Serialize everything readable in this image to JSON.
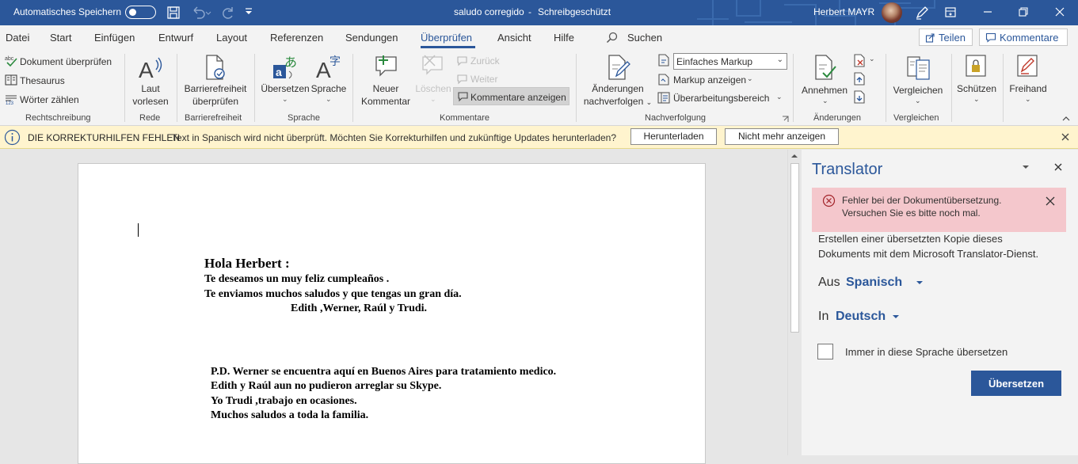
{
  "title_bar": {
    "autosave_label": "Automatisches Speichern",
    "doc_title": "saludo corregido",
    "separator": "-",
    "read_only": "Schreibgeschützt",
    "user_name": "Herbert MAYR"
  },
  "menu": {
    "tabs": [
      "Datei",
      "Start",
      "Einfügen",
      "Entwurf",
      "Layout",
      "Referenzen",
      "Sendungen",
      "Überprüfen",
      "Ansicht",
      "Hilfe"
    ],
    "active": "Überprüfen",
    "search": "Suchen",
    "share": "Teilen",
    "comments": "Kommentare"
  },
  "ribbon": {
    "proofing": {
      "spelling": "Dokument überprüfen",
      "thesaurus": "Thesaurus",
      "word_count": "Wörter zählen",
      "group": "Rechtschreibung"
    },
    "speech": {
      "read_aloud_1": "Laut",
      "read_aloud_2": "vorlesen",
      "group": "Rede"
    },
    "accessibility": {
      "check_1": "Barrierefreiheit",
      "check_2": "überprüfen",
      "group": "Barrierefreiheit"
    },
    "language": {
      "translate": "Übersetzen",
      "language": "Sprache",
      "group": "Sprache"
    },
    "comments": {
      "new_1": "Neuer",
      "new_2": "Kommentar",
      "delete": "Löschen",
      "previous": "Zurück",
      "next": "Weiter",
      "show": "Kommentare anzeigen",
      "group": "Kommentare"
    },
    "tracking": {
      "track_1": "Änderungen",
      "track_2": "nachverfolgen",
      "markup_select": "Einfaches Markup",
      "show_markup": "Markup anzeigen",
      "reviewing_pane": "Überarbeitungsbereich",
      "group": "Nachverfolgung"
    },
    "changes": {
      "accept": "Annehmen",
      "group": "Änderungen"
    },
    "compare": {
      "compare": "Vergleichen",
      "group": "Vergleichen"
    },
    "protect": {
      "protect": "Schützen"
    },
    "ink": {
      "ink": "Freihand"
    }
  },
  "message_bar": {
    "title": "DIE KORREKTURHILFEN FEHLEN",
    "text": "Text in Spanisch wird nicht überprüft. Möchten Sie Korrekturhilfen und zukünftige Updates herunterladen?",
    "download": "Herunterladen",
    "dont_show": "Nicht mehr anzeigen"
  },
  "document": {
    "greeting": "Hola Herbert :",
    "line1": "Te deseamos un muy feliz cumpleaños .",
    "line2": "Te enviamos muchos saludos y que tengas un gran día.",
    "signature": "Edith ,Werner, Raúl y Trudi.",
    "ps1": "P.D.  Werner se encuentra aquí en Buenos Aires para tratamiento medico.",
    "ps2": "Edith y Raúl aun no pudieron arreglar su Skype.",
    "ps3": "Yo Trudi ,trabajo en ocasiones.",
    "ps4": "Muchos saludos a toda la familia."
  },
  "translator": {
    "title": "Translator",
    "error_line1": "Fehler bei der Dokumentübersetzung.",
    "error_line2": "Versuchen Sie es bitte noch mal.",
    "desc_line1": "Erstellen einer übersetzten Kopie dieses",
    "desc_line2": "Dokuments mit dem Microsoft Translator-Dienst.",
    "from_label": "Aus",
    "from_value": "Spanisch",
    "to_label": "In",
    "to_value": "Deutsch",
    "always_label": "Immer in diese Sprache übersetzen",
    "translate_button": "Übersetzen"
  },
  "colors": {
    "brand": "#2b579a",
    "message_bar": "#fff4ce",
    "error": "#f4c7cc",
    "accent": "#2b579a"
  }
}
